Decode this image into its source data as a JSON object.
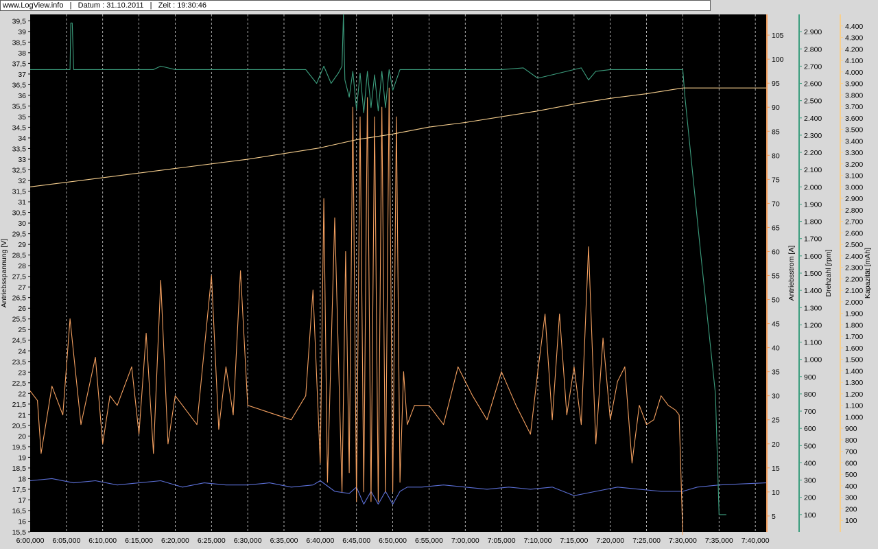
{
  "header": {
    "site": "www.LogView.info",
    "date_label": "Datum : 31.10.2011",
    "time_label": "Zeit : 19:30:46",
    "separator": "|"
  },
  "chart_data": {
    "type": "line",
    "colors": {
      "plot_bg": "#000000",
      "voltage": "#5b6fd6",
      "current": "#f4a060",
      "rpm": "#3c9e7e",
      "capacity": "#f7cf8e",
      "grid": "#ffffff"
    },
    "x": {
      "ticks": [
        "6:00,000",
        "6:05,000",
        "6:10,000",
        "6:15,000",
        "6:20,000",
        "6:25,000",
        "6:30,000",
        "6:35,000",
        "6:40,000",
        "6:45,000",
        "6:50,000",
        "6:55,000",
        "7:00,000",
        "7:05,000",
        "7:10,000",
        "7:15,000",
        "7:20,000",
        "7:25,000",
        "7:30,000",
        "7:35,000",
        "7:40,000"
      ],
      "range": [
        0,
        101.5
      ],
      "unit": "min"
    },
    "axes": {
      "voltage": {
        "label": "Antriebsspannung [V]",
        "range": [
          15.5,
          39.8
        ],
        "ticks": [
          "15,5",
          "16",
          "16,5",
          "17",
          "17,5",
          "18",
          "18,5",
          "19",
          "19,5",
          "20",
          "20,5",
          "21",
          "21,5",
          "22",
          "22,5",
          "23",
          "23,5",
          "24",
          "24,5",
          "25",
          "25,5",
          "26",
          "26,5",
          "27",
          "27,5",
          "28",
          "28,5",
          "29",
          "29,5",
          "30",
          "30,5",
          "31",
          "31,5",
          "32",
          "32,5",
          "33",
          "33,5",
          "34",
          "34,5",
          "35",
          "35,5",
          "36",
          "36,5",
          "37",
          "37,5",
          "38",
          "38,5",
          "39",
          "39,5"
        ]
      },
      "current": {
        "label": "Antriebsstrom [A]",
        "range": [
          1.7,
          109.3
        ],
        "ticks": [
          "5",
          "10",
          "15",
          "20",
          "25",
          "30",
          "35",
          "40",
          "45",
          "50",
          "55",
          "60",
          "65",
          "70",
          "75",
          "80",
          "85",
          "90",
          "95",
          "100",
          "105"
        ]
      },
      "rpm": {
        "label": "Drehzahl [rpm]",
        "range": [
          0,
          3000
        ],
        "ticks": [
          "100",
          "200",
          "300",
          "400",
          "500",
          "600",
          "700",
          "800",
          "900",
          "1.000",
          "1.100",
          "1.200",
          "1.300",
          "1.400",
          "1.500",
          "1.600",
          "1.700",
          "1.800",
          "1.900",
          "2.000",
          "2.100",
          "2.200",
          "2.300",
          "2.400",
          "2.500",
          "2.600",
          "2.700",
          "2.800",
          "2.900"
        ]
      },
      "capacity": {
        "label": "Kapazität [mAh]",
        "range": [
          0,
          4500
        ],
        "ticks": [
          "100",
          "200",
          "300",
          "400",
          "500",
          "600",
          "700",
          "800",
          "900",
          "1.000",
          "1.100",
          "1.200",
          "1.300",
          "1.400",
          "1.500",
          "1.600",
          "1.700",
          "1.800",
          "1.900",
          "2.000",
          "2.100",
          "2.200",
          "2.300",
          "2.400",
          "2.500",
          "2.600",
          "2.700",
          "2.800",
          "2.900",
          "3.000",
          "3.100",
          "3.200",
          "3.300",
          "3.400",
          "3.500",
          "3.600",
          "3.700",
          "3.800",
          "3.900",
          "4.000",
          "4.100",
          "4.200",
          "4.300",
          "4.400"
        ]
      }
    },
    "series": [
      {
        "name": "Antriebsspannung [V]",
        "axis": "voltage",
        "x": [
          0,
          3,
          6,
          9,
          12,
          15,
          18,
          21,
          24,
          27,
          30,
          33,
          36,
          39,
          40,
          42,
          44,
          45,
          46,
          47,
          48,
          49,
          50,
          51,
          52,
          54,
          57,
          60,
          63,
          66,
          69,
          72,
          75,
          78,
          81,
          84,
          87,
          90,
          91,
          92,
          95,
          98,
          101.5
        ],
        "y": [
          17.9,
          18.0,
          17.8,
          17.9,
          17.7,
          17.8,
          17.9,
          17.6,
          17.8,
          17.7,
          17.7,
          17.8,
          17.6,
          17.7,
          17.9,
          17.4,
          17.3,
          17.6,
          16.8,
          17.4,
          16.8,
          17.4,
          16.8,
          17.4,
          17.6,
          17.6,
          17.7,
          17.6,
          17.5,
          17.6,
          17.5,
          17.6,
          17.2,
          17.4,
          17.6,
          17.5,
          17.4,
          17.4,
          17.5,
          17.6,
          17.7,
          17.75,
          17.8
        ]
      },
      {
        "name": "Antriebsstrom [A]",
        "axis": "current",
        "x": [
          0,
          1,
          1.5,
          3,
          4.5,
          5.5,
          7,
          9,
          10,
          11,
          12,
          14,
          15,
          16,
          17,
          18,
          19,
          20,
          21,
          23,
          25,
          26,
          27,
          28,
          29,
          30,
          32,
          34,
          36,
          38,
          39,
          40,
          40.5,
          41,
          42,
          43,
          43.5,
          44,
          44.5,
          45,
          45.5,
          46,
          46.5,
          47,
          47.5,
          48,
          48.5,
          49,
          49.5,
          50,
          50.5,
          51,
          51.5,
          52,
          53,
          55,
          57,
          59,
          61,
          63,
          65,
          67,
          69,
          70,
          71,
          72,
          73,
          74,
          75,
          76,
          77,
          78,
          79,
          80,
          81,
          82,
          83,
          84,
          85,
          86,
          87,
          88,
          89,
          89.5,
          90
        ],
        "y": [
          31,
          29,
          18,
          32,
          26,
          46,
          24,
          38,
          20,
          30,
          28,
          36,
          22,
          43,
          18,
          54,
          20,
          30,
          28,
          24,
          55,
          23,
          36,
          26,
          56,
          28,
          27,
          26,
          25,
          30,
          52,
          16,
          71,
          12,
          67,
          10,
          60,
          14,
          90,
          8,
          88,
          10,
          92,
          8,
          88,
          8,
          90,
          10,
          94,
          10,
          88,
          12,
          35,
          24,
          28,
          28,
          24,
          36,
          30,
          25,
          35,
          28,
          22,
          35,
          47,
          25,
          47,
          26,
          36,
          24,
          61,
          20,
          42,
          25,
          33,
          36,
          16,
          28,
          24,
          25,
          30,
          28,
          27,
          26,
          1
        ]
      },
      {
        "name": "Drehzahl [rpm]",
        "axis": "rpm",
        "x": [
          0,
          5.5,
          5.6,
          5.8,
          6,
          12,
          17,
          18,
          20,
          25,
          35,
          38,
          39.5,
          40.5,
          41.5,
          42.5,
          43,
          43.2,
          43.4,
          44,
          44.5,
          45,
          45.5,
          46,
          46.5,
          47,
          47.5,
          48,
          48.5,
          49,
          49.5,
          50,
          51,
          52,
          55,
          60,
          65,
          68,
          70,
          75,
          76,
          77,
          78,
          80,
          85,
          90,
          90.3,
          92.5,
          94.5,
          95,
          96
        ],
        "y": [
          2680,
          2680,
          2950,
          2950,
          2680,
          2680,
          2680,
          2700,
          2680,
          2680,
          2680,
          2680,
          2600,
          2700,
          2600,
          2660,
          2700,
          3000,
          2620,
          2520,
          2670,
          2450,
          2660,
          2430,
          2670,
          2460,
          2650,
          2440,
          2670,
          2460,
          2680,
          2560,
          2680,
          2680,
          2680,
          2680,
          2680,
          2690,
          2630,
          2680,
          2690,
          2620,
          2670,
          2680,
          2680,
          2680,
          2520,
          1600,
          800,
          100,
          100
        ]
      },
      {
        "name": "Kapazität [mAh]",
        "axis": "capacity",
        "x": [
          0,
          10,
          20,
          30,
          40,
          45,
          50,
          55,
          60,
          65,
          70,
          75,
          80,
          85,
          90,
          95,
          101.5
        ],
        "y": [
          3000,
          3080,
          3160,
          3240,
          3340,
          3410,
          3460,
          3520,
          3560,
          3610,
          3660,
          3720,
          3770,
          3810,
          3860,
          3860,
          3860
        ]
      }
    ]
  }
}
